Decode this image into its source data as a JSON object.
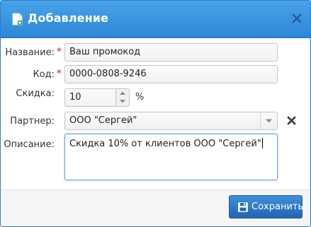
{
  "dialog": {
    "title": "Добавление",
    "title_icon": "document-add-icon",
    "close_icon": "close-icon"
  },
  "form": {
    "name": {
      "label": "Название:",
      "required_mark": "*",
      "value": "Ваш промокод"
    },
    "code": {
      "label": "Код:",
      "required_mark": "*",
      "value": "0000-0808-9246"
    },
    "discount": {
      "label": "Скидка:",
      "value": "10",
      "unit": "%"
    },
    "partner": {
      "label": "Партнер:",
      "selected": "ООО \"Сергей\"",
      "clear_icon": "clear-x-icon"
    },
    "description": {
      "label": "Описание:",
      "value": "Скидка 10% от клиентов ООО \"Сергей\""
    }
  },
  "footer": {
    "save_label": "Сохранить",
    "save_icon": "floppy-disk-icon"
  },
  "colors": {
    "titlebar": "#2c86d6",
    "required": "#d9534f",
    "button": "#2264b2"
  }
}
